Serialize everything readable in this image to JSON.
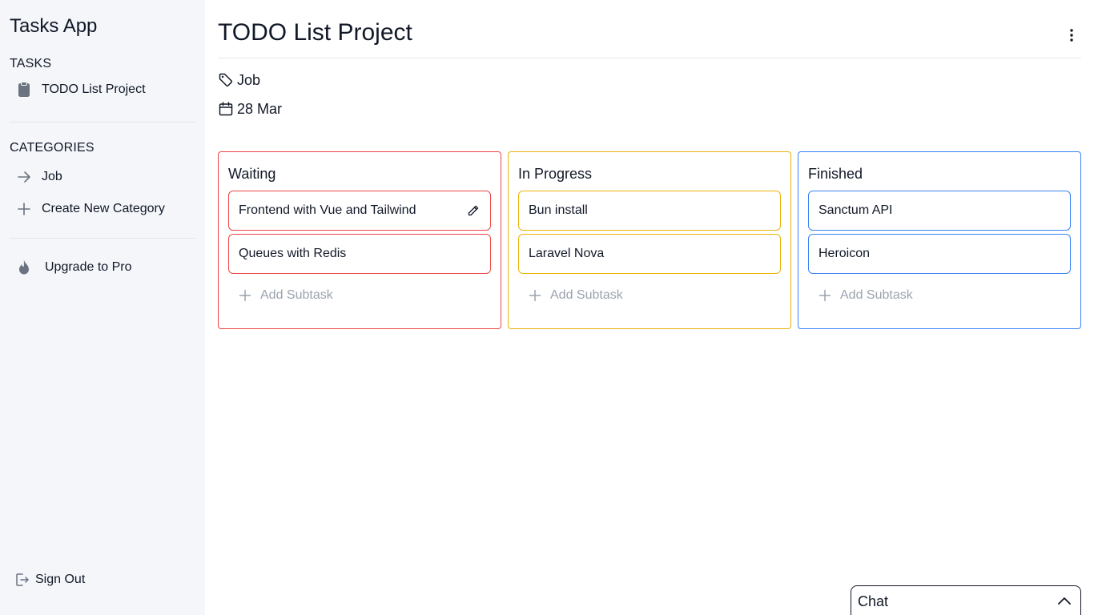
{
  "app": {
    "title": "Tasks App"
  },
  "sidebar": {
    "tasks_heading": "TASKS",
    "tasks": [
      {
        "label": "TODO List Project",
        "icon": "clipboard-icon"
      }
    ],
    "categories_heading": "CATEGORIES",
    "categories": [
      {
        "label": "Job",
        "icon": "arrow-right-icon"
      },
      {
        "label": "Create New Category",
        "icon": "plus-icon"
      }
    ],
    "upgrade": {
      "label": "Upgrade to Pro",
      "icon": "fire-icon"
    },
    "signout": {
      "label": "Sign Out",
      "icon": "sign-out-icon"
    }
  },
  "main": {
    "title": "TODO List Project",
    "category": "Job",
    "date": "28 Mar",
    "columns": [
      {
        "title": "Waiting",
        "color": "#ef4444",
        "cards": [
          "Frontend with Vue and Tailwind",
          "Queues with Redis"
        ],
        "add_label": "Add Subtask"
      },
      {
        "title": "In Progress",
        "color": "#eab308",
        "cards": [
          "Bun install",
          "Laravel Nova"
        ],
        "add_label": "Add Subtask"
      },
      {
        "title": "Finished",
        "color": "#3b82f6",
        "cards": [
          "Sanctum API",
          "Heroicon"
        ],
        "add_label": "Add Subtask"
      }
    ]
  },
  "chat": {
    "label": "Chat"
  },
  "colors": {
    "sidebar_bg": "#f4f6fa",
    "icon_gray": "#6b7280",
    "muted_text": "#9ca3af"
  }
}
